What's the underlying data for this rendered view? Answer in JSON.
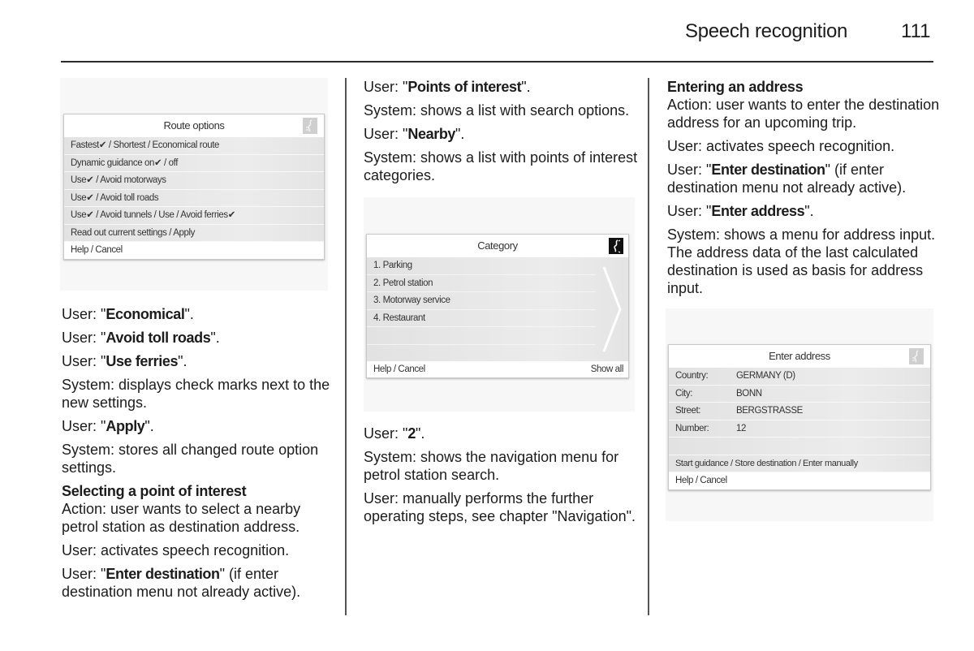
{
  "header": {
    "title": "Speech recognition",
    "page_number": "111"
  },
  "route_options_screen": {
    "title": "Route options",
    "icon": "voice-speech-icon",
    "rows": [
      "Fastest✔ / Shortest / Economical route",
      "Dynamic guidance on✔ / off",
      "Use✔ / Avoid motorways",
      "Use✔ / Avoid toll roads",
      "Use✔ / Avoid tunnels / Use / Avoid ferries✔",
      "Read out current settings / Apply"
    ],
    "footer": "Help / Cancel"
  },
  "column1": {
    "paragraphs": [
      {
        "prefix": "User: \"",
        "bold": "Economical",
        "suffix": "\"."
      },
      {
        "prefix": "User: \"",
        "bold": "Avoid toll roads",
        "suffix": "\"."
      },
      {
        "prefix": "User: \"",
        "bold": "Use ferries",
        "suffix": "\"."
      },
      {
        "text": "System: displays check marks next to the new settings."
      },
      {
        "prefix": "User: \"",
        "bold": "Apply",
        "suffix": "\"."
      },
      {
        "text": "System: stores all changed route option settings."
      }
    ],
    "section_heading": "Selecting a point of interest",
    "section_paragraphs": [
      {
        "text": "Action: user wants to select a nearby petrol station as destination address."
      },
      {
        "text": "User: activates speech recognition."
      },
      {
        "prefix": "User: \"",
        "bold": "Enter destination",
        "suffix": "\" (if enter destination menu not already active)."
      }
    ]
  },
  "column2": {
    "paragraphs_top": [
      {
        "prefix": "User: \"",
        "bold": "Points of interest",
        "suffix": "\"."
      },
      {
        "text": "System: shows a list with search options."
      },
      {
        "prefix": "User: \"",
        "bold": "Nearby",
        "suffix": "\"."
      },
      {
        "text": "System: shows a list with points of interest categories."
      }
    ],
    "paragraphs_bottom": [
      {
        "prefix": "User: \"",
        "bold": "2",
        "suffix": "\"."
      },
      {
        "text": "System: shows the navigation menu for petrol station search."
      },
      {
        "text": "User: manually performs the further operating steps, see chapter \"Navigation\"."
      }
    ]
  },
  "category_screen": {
    "title": "Category",
    "icon": "voice-speech-icon",
    "items": [
      "1. Parking",
      "2. Petrol station",
      "3. Motorway service",
      "4. Restaurant",
      ""
    ],
    "footer_left": "Help / Cancel",
    "footer_right": "Show all"
  },
  "column3": {
    "section_heading": "Entering an address",
    "paragraphs": [
      {
        "text": "Action: user wants to enter the destination address for an upcoming trip."
      },
      {
        "text": "User: activates speech recognition."
      },
      {
        "prefix": "User: \"",
        "bold": "Enter destination",
        "suffix": "\" (if enter destination menu not already active)."
      },
      {
        "prefix": "User: \"",
        "bold": "Enter address",
        "suffix": "\"."
      },
      {
        "text": "System: shows a menu for address input. The address data of the last calculated destination is used as basis for address input."
      }
    ]
  },
  "address_screen": {
    "title": "Enter address",
    "icon": "voice-speech-icon",
    "fields": [
      {
        "label": "Country:",
        "value": "GERMANY (D)"
      },
      {
        "label": "City:",
        "value": "BONN"
      },
      {
        "label": "Street:",
        "value": "BERGSTRASSE"
      },
      {
        "label": "Number:",
        "value": "12"
      },
      {
        "label": "",
        "value": ""
      }
    ],
    "actions": "Start guidance / Store destination / Enter manually",
    "footer": "Help / Cancel"
  }
}
